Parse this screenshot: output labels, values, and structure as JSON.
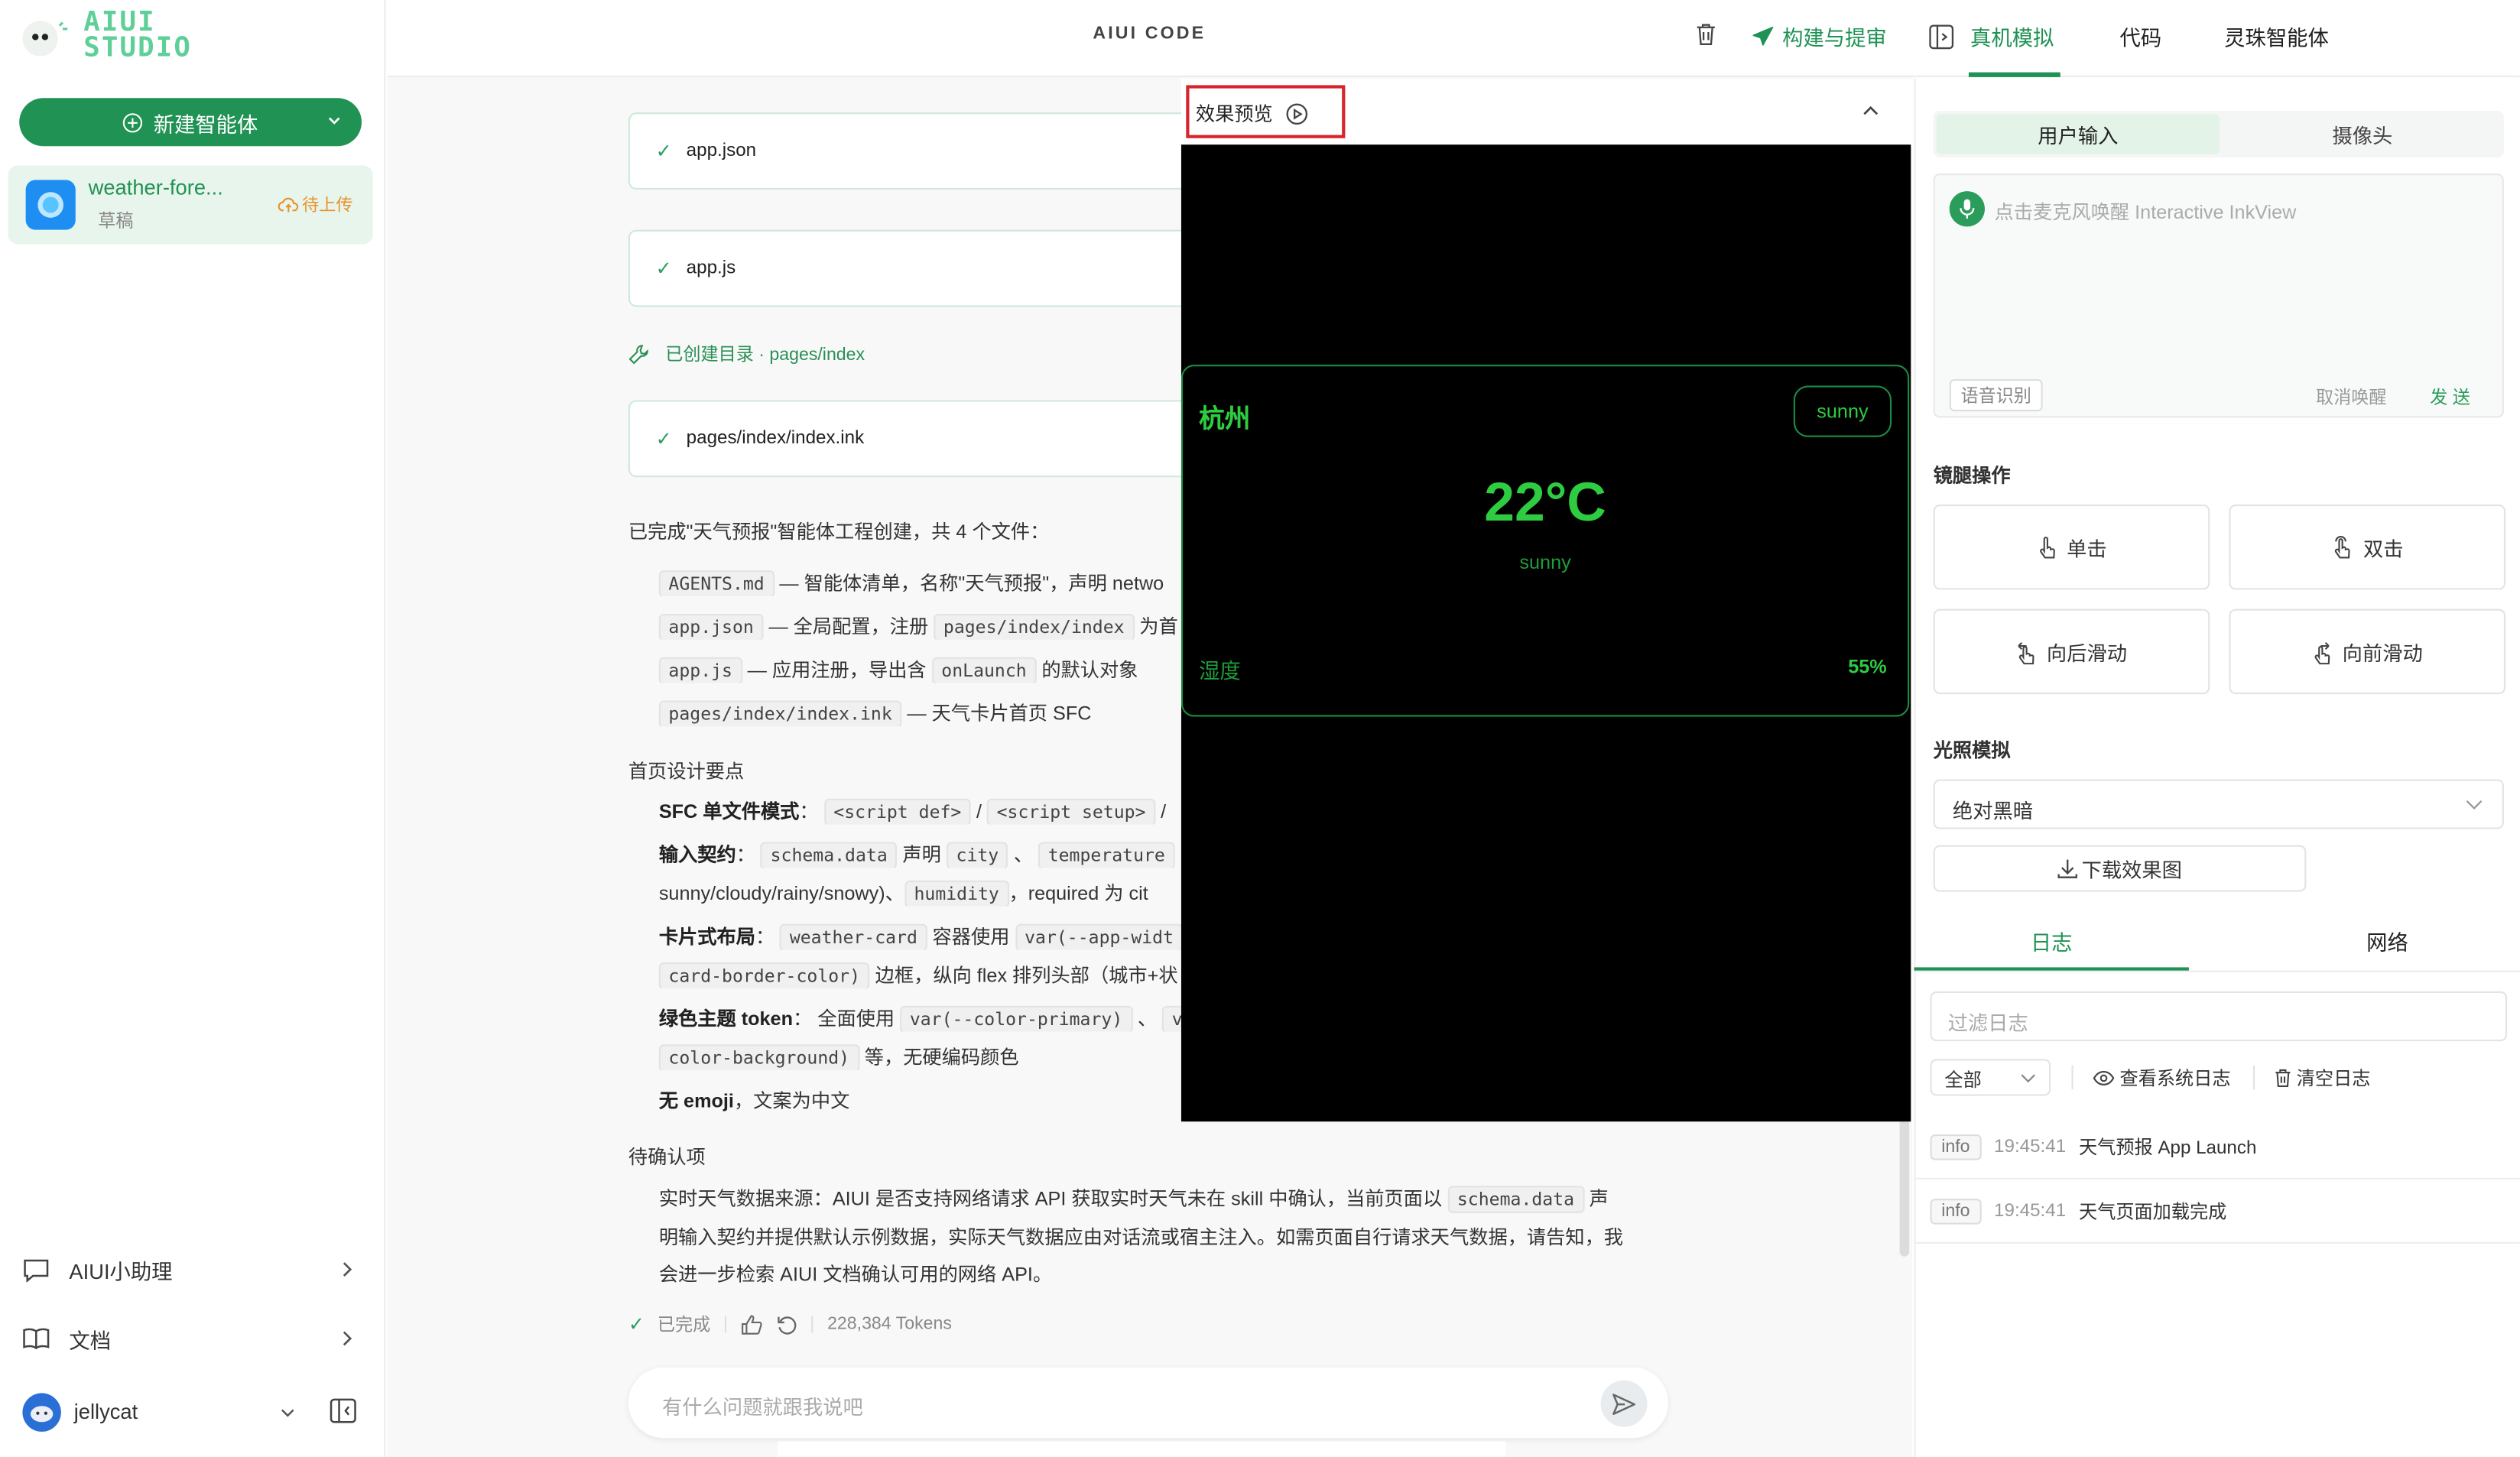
{
  "brand": {
    "line1": "AIUI",
    "line2": "STUDIO"
  },
  "sidebar": {
    "new_agent_label": "新建智能体",
    "agent": {
      "name": "weather-fore...",
      "status": "草稿",
      "upload_label": "待上传"
    },
    "assistant_label": "AIUI小助理",
    "docs_label": "文档",
    "user_name": "jellycat"
  },
  "header": {
    "title": "AIUI CODE",
    "tabs": [
      "构建与提审",
      "真机模拟",
      "代码",
      "灵珠智能体"
    ],
    "active_tab": "真机模拟"
  },
  "chat": {
    "files": [
      "app.json",
      "app.js",
      "pages/index/index.ink"
    ],
    "dir_created": "已创建目录 · pages/index",
    "summary": "已完成\"天气预报\"智能体工程创建，共 4 个文件：",
    "file_list": [
      {
        "code": "AGENTS.md",
        "text": "— 智能体清单，名称\"天气预报\"，声明 netwo"
      },
      {
        "code": "app.json",
        "text": "— 全局配置，注册",
        "code2": "pages/index/index",
        "text2": "为首"
      },
      {
        "code": "app.js",
        "text": "— 应用注册，导出含",
        "code2": "onLaunch",
        "text2": "的默认对象"
      },
      {
        "code": "pages/index/index.ink",
        "text": "— 天气卡片首页 SFC"
      }
    ],
    "design_heading": "首页设计要点",
    "design": {
      "sfc_label": "SFC 单文件模式",
      "sfc_code1": "<script def>",
      "sfc_code2": "<script setup>",
      "input_label": "输入契约",
      "input_code1": "schema.data",
      "input_text1": "声明",
      "input_code2": "city",
      "input_code3": "temperature",
      "input_line2_text": "sunny/cloudy/rainy/snowy)、",
      "input_code4": "humidity",
      "input_line2_tail": "，required 为 cit",
      "card_label": "卡片式布局",
      "card_code1": "weather-card",
      "card_text1": "容器使用",
      "card_code2": "var(--app-widt",
      "card_code3": "card-border-color)",
      "card_text2": "边框，纵向 flex 排列头部（城市+状",
      "green_label": "绿色主题 token",
      "green_text1": "全面使用",
      "green_code1": "var(--color-primary)",
      "green_code2": "color-background)",
      "green_text2": "等，无硬编码颜色",
      "emoji_label": "无 emoji",
      "emoji_text": "，文案为中文"
    },
    "pending_heading": "待确认项",
    "pending_text1": "实时天气数据来源：AIUI 是否支持网络请求 API 获取实时天气未在 skill 中确认，当前页面以",
    "pending_code": "schema.data",
    "pending_text1b": "声",
    "pending_text2": "明输入契约并提供默认示例数据，实际天气数据应由对话流或宿主注入。如需页面自行请求天气数据，请告知，我",
    "pending_text3": "会进一步检索 AIUI 文档确认可用的网络 API。",
    "done_label": "已完成",
    "tokens": "228,384 Tokens",
    "input_placeholder": "有什么问题就跟我说吧"
  },
  "preview": {
    "title": "效果预览",
    "city": "杭州",
    "badge": "sunny",
    "temperature": "22°C",
    "condition": "sunny",
    "humidity_label": "湿度",
    "humidity_value": "55%"
  },
  "right_panel": {
    "tabs": [
      "用户输入",
      "摄像头"
    ],
    "active_tab": "用户输入",
    "mic_placeholder": "点击麦克风唤醒 Interactive InkView",
    "voice_tag": "语音识别",
    "cancel_label": "取消唤醒",
    "send_label": "发 送",
    "gesture_title": "镜腿操作",
    "gestures": [
      "单击",
      "双击",
      "向后滑动",
      "向前滑动"
    ],
    "light_title": "光照模拟",
    "light_value": "绝对黑暗",
    "download_label": "下载效果图",
    "log_tabs": [
      "日志",
      "网络"
    ],
    "log_filter_placeholder": "过滤日志",
    "log_level": "全部",
    "view_system_log": "查看系统日志",
    "clear_log": "清空日志",
    "logs": [
      {
        "level": "info",
        "time": "19:45:41",
        "msg": "天气预报 App Launch"
      },
      {
        "level": "info",
        "time": "19:45:41",
        "msg": "天气页面加载完成"
      }
    ]
  },
  "colors": {
    "brand_green": "#1f9254",
    "accent": "#2a9d5c",
    "screen_green": "#2ecc40",
    "highlight_box": "#d9242b"
  }
}
